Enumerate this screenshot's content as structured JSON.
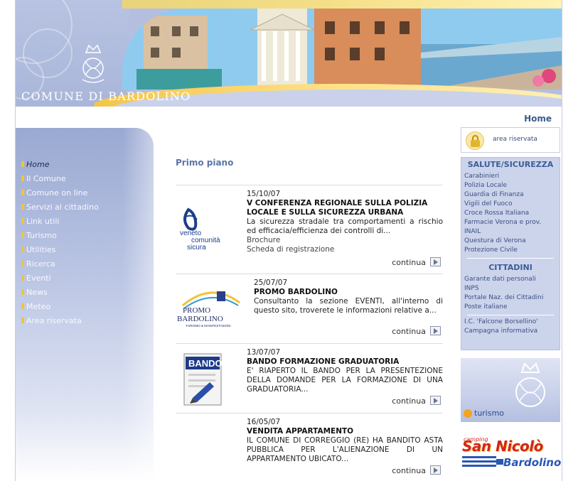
{
  "header": {
    "town_name": "COMUNE DI BARDOLINO"
  },
  "top_nav": {
    "home": "Home"
  },
  "sidebar": {
    "items": [
      {
        "label": "Home",
        "active": true
      },
      {
        "label": "Il Comune"
      },
      {
        "label": "Comune on line"
      },
      {
        "label": "Servizi al cittadino"
      },
      {
        "label": "Link utili"
      },
      {
        "label": "Turismo"
      },
      {
        "label": "Utilities"
      },
      {
        "label": "Ricerca"
      },
      {
        "label": "Eventi"
      },
      {
        "label": "News"
      },
      {
        "label": "Meteo"
      },
      {
        "label": "Area riservata"
      }
    ]
  },
  "main": {
    "section_title": "Primo piano",
    "continue_label": "continua",
    "news": [
      {
        "date": "15/10/07",
        "title": "V CONFERENZA REGIONALE SULLA POLIZIA LOCALE E SULLA SICUREZZA URBANA",
        "text": "La sicurezza stradale tra comportamenti a rischio ed efficacia/efficienza dei controlli di...",
        "links": [
          "Brochure",
          "Scheda di registrazione"
        ],
        "thumb_text": [
          "veneto",
          "comunità",
          "sicura"
        ]
      },
      {
        "date": "25/07/07",
        "title": "PROMO BARDOLINO",
        "text": "Consultanto la sezione EVENTI, all'interno di questo sito, troverete le informazioni relative a...",
        "thumb_text": [
          "PROMO",
          "BARDOLINO",
          "TURISMO & MANIFESTAZIONI"
        ]
      },
      {
        "date": "13/07/07",
        "title": "BANDO FORMAZIONE GRADUATORIA",
        "text": "E' RIAPERTO IL BANDO PER LA PRESENTEZIONE DELLA DOMANDE PER LA FORMAZIONE DI UNA GRADUATORIA...",
        "thumb_text": [
          "BANDO"
        ]
      },
      {
        "date": "16/05/07",
        "title": "VENDITA APPARTAMENTO",
        "text": "IL COMUNE DI CORREGGIO (RE) HA BANDITO ASTA PUBBLICA PER L'ALIENAZIONE DI UN APPARTAMENTO UBICATO..."
      }
    ]
  },
  "right": {
    "area_riservata": "area riservata",
    "salute_head": "SALUTE/SICUREZZA",
    "salute_links": [
      "Carabinieri",
      "Polizia Locale",
      "Guardia di Finanza",
      "Vigili del Fuoco",
      "Croce Rossa Italiana",
      "Farmacie Verona e prov.",
      "INAIL",
      "Questura di Verona",
      "Protezione Civile"
    ],
    "cittadini_head": "CITTADINI",
    "cittadini_links": [
      "Garante dati personali",
      "INPS",
      "Portale Naz. dei Cittadini",
      "Poste italiane"
    ],
    "extra_links": [
      "I.C. 'Falcone Borsellino'",
      "Campagna informativa"
    ],
    "turismo_banner": "turismo",
    "camping_banner": {
      "small": "camping",
      "name": "San Nicolò",
      "town": "Bardolino"
    }
  },
  "colors": {
    "accent": "#3c5a8c",
    "nav_bullet": "#f0c43a",
    "box_bg": "#ccd4ec"
  }
}
